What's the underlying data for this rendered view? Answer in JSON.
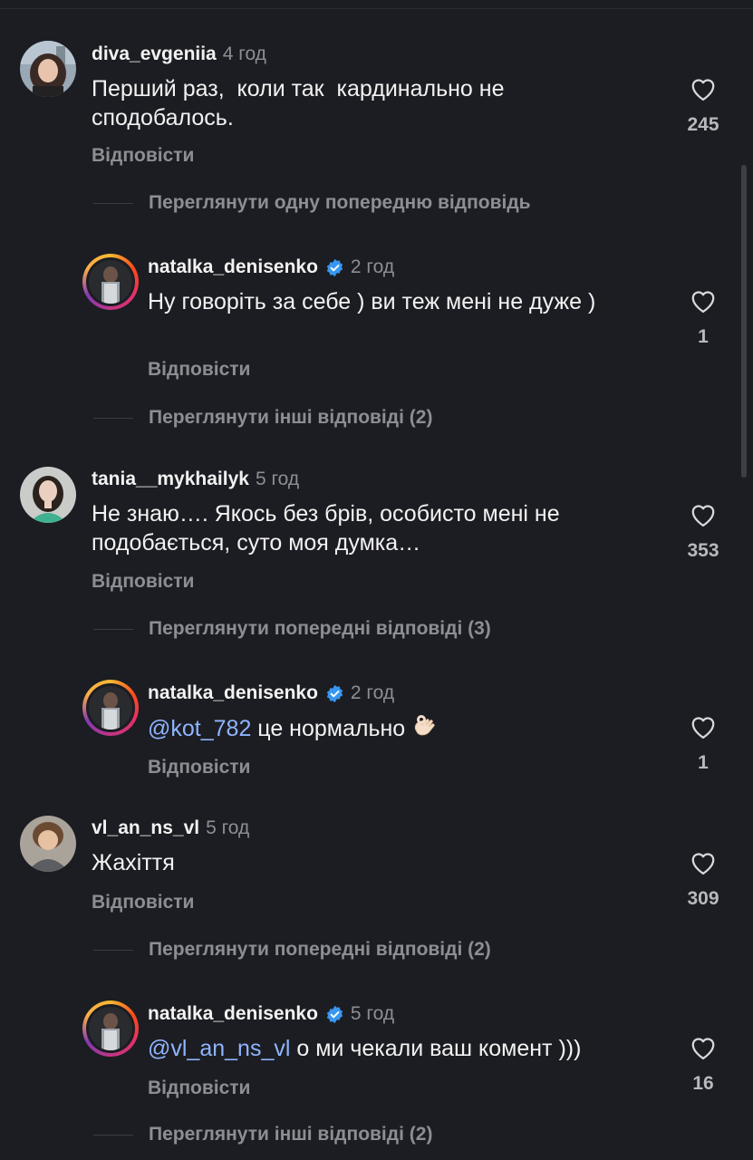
{
  "comments": [
    {
      "username": "diva_evgeniia",
      "time": "4 год",
      "text": "Перший раз,  коли так  кардинально не сподобалось.",
      "reply_label": "Відповісти",
      "likes": "245",
      "more_replies": "Переглянути одну попередню відповідь"
    },
    {
      "username": "natalka_denisenko",
      "verified": true,
      "time": "2 год",
      "text": "Ну говоріть за себе ) ви теж мені не дуже )",
      "reply_label": "Відповісти",
      "likes": "1",
      "more_replies": "Переглянути інші відповіді (2)"
    },
    {
      "username": "tania__mykhailyk",
      "time": "5 год",
      "text": "Не знаю…. Якось без брів, особисто мені не подобається, суто моя думка…",
      "reply_label": "Відповісти",
      "likes": "353",
      "more_replies": "Переглянути попередні відповіді (3)"
    },
    {
      "username": "natalka_denisenko",
      "verified": true,
      "time": "2 год",
      "mention": "@kot_782",
      "text": " це нормально",
      "emoji": "ok-hand-icon",
      "reply_label": "Відповісти",
      "likes": "1"
    },
    {
      "username": "vl_an_ns_vl",
      "time": "5 год",
      "text": "Жахіття",
      "reply_label": "Відповісти",
      "likes": "309",
      "more_replies": "Переглянути попередні відповіді (2)"
    },
    {
      "username": "natalka_denisenko",
      "verified": true,
      "time": "5 год",
      "mention": "@vl_an_ns_vl",
      "text": " о ми чекали ваш комент )))",
      "reply_label": "Відповісти",
      "likes": "16",
      "more_replies": "Переглянути інші відповіді (2)"
    }
  ],
  "colors": {
    "background": "#1c1d22",
    "text": "#f2f2f2",
    "muted": "#8d8e93",
    "mention": "#8fb5ff",
    "verified": "#3897f0"
  },
  "icons": {
    "like": "heart-outline-icon",
    "verified": "verified-badge-icon"
  }
}
